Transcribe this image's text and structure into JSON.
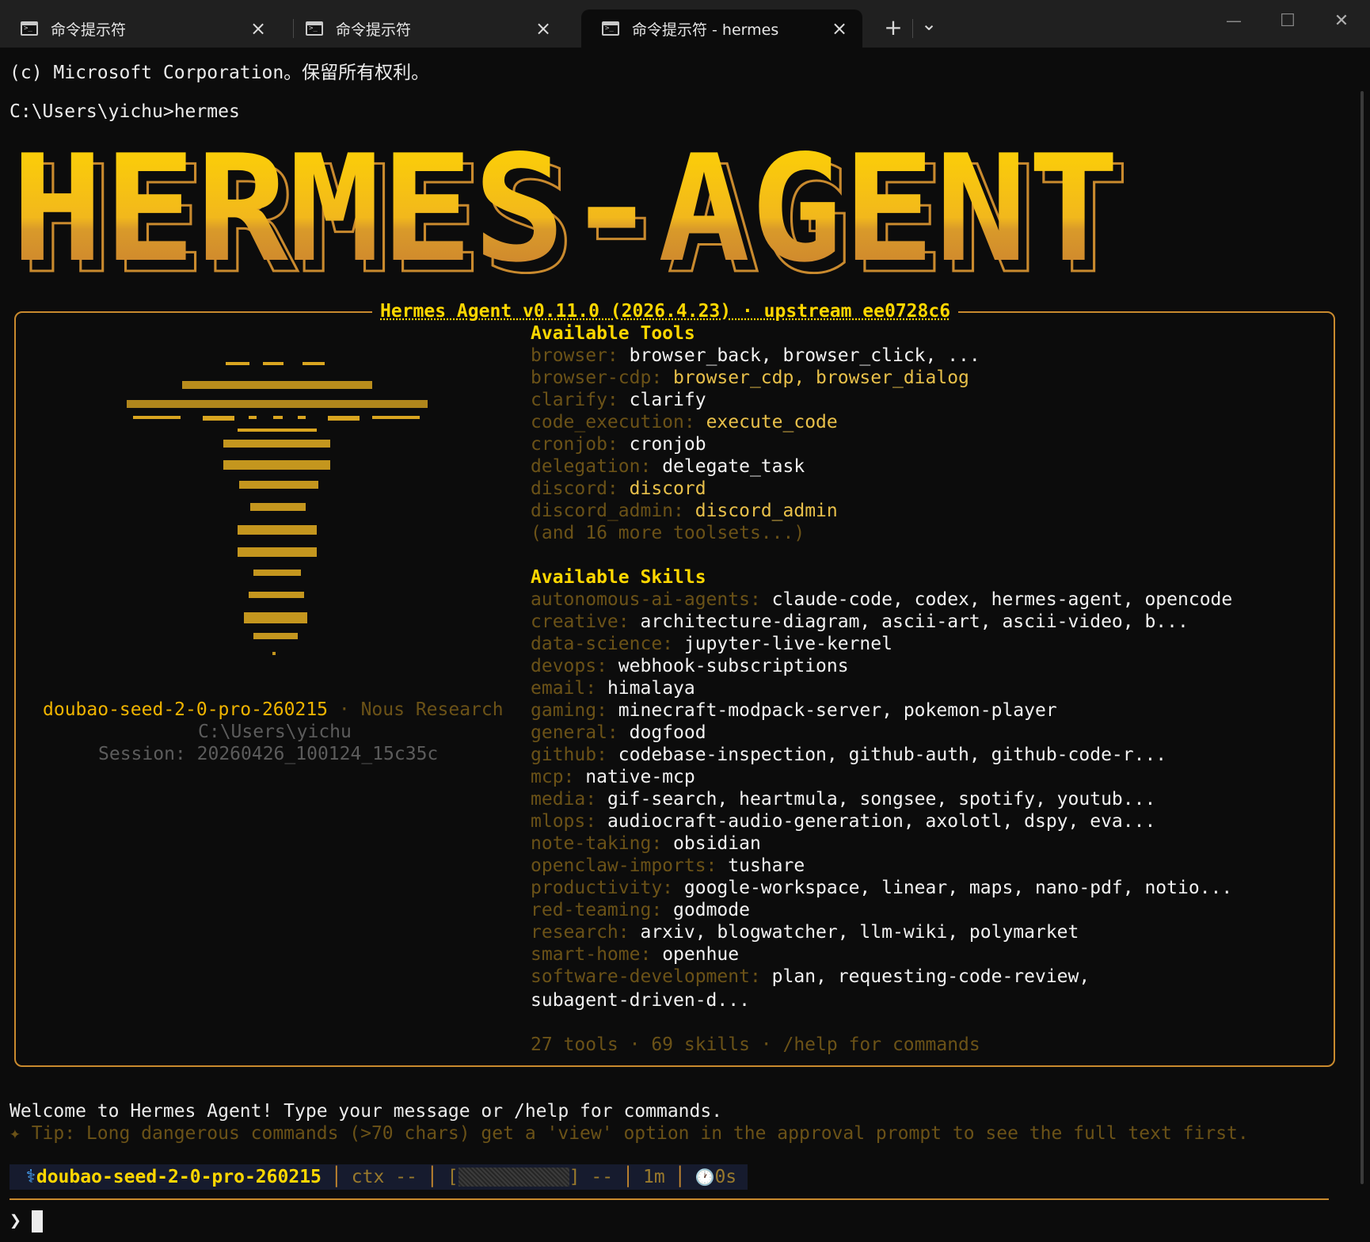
{
  "tabs": [
    {
      "label": "命令提示符",
      "active": false
    },
    {
      "label": "命令提示符",
      "active": false
    },
    {
      "label": "命令提示符 - hermes",
      "active": true
    }
  ],
  "window_controls": {
    "new_tab": "+",
    "dropdown": "⌄",
    "minimize": "—",
    "maximize": "☐",
    "close": "✕"
  },
  "terminal": {
    "copyright": "(c) Microsoft Corporation。保留所有权利。",
    "command_line": "C:\\Users\\yichu>hermes",
    "banner_text": "HERMES-AGENT"
  },
  "panel": {
    "title": "Hermes Agent v0.11.0 (2026.4.23) · upstream ee0728c6",
    "model": "doubao-seed-2-0-pro-260215",
    "provider": "· Nous Research",
    "cwd": "C:\\Users\\yichu",
    "session": "Session: 20260426_100124_15c35c",
    "tools_heading": "Available Tools",
    "tools": [
      {
        "cat": "browser:",
        "val": "browser_back, browser_click, ...",
        "gold": false
      },
      {
        "cat": "browser-cdp:",
        "val": "browser_cdp, browser_dialog",
        "gold": true
      },
      {
        "cat": "clarify:",
        "val": "clarify",
        "gold": false
      },
      {
        "cat": "code_execution:",
        "val": "execute_code",
        "gold": true
      },
      {
        "cat": "cronjob:",
        "val": "cronjob",
        "gold": false
      },
      {
        "cat": "delegation:",
        "val": "delegate_task",
        "gold": false
      },
      {
        "cat": "discord:",
        "val": "discord",
        "gold": true
      },
      {
        "cat": "discord_admin:",
        "val": "discord_admin",
        "gold": true
      }
    ],
    "tools_more": "(and 16 more toolsets...)",
    "skills_heading": "Available Skills",
    "skills": [
      {
        "cat": "autonomous-ai-agents:",
        "val": "claude-code, codex, hermes-agent, opencode"
      },
      {
        "cat": "creative:",
        "val": "architecture-diagram, ascii-art, ascii-video, b..."
      },
      {
        "cat": "data-science:",
        "val": "jupyter-live-kernel"
      },
      {
        "cat": "devops:",
        "val": "webhook-subscriptions"
      },
      {
        "cat": "email:",
        "val": "himalaya"
      },
      {
        "cat": "gaming:",
        "val": "minecraft-modpack-server, pokemon-player"
      },
      {
        "cat": "general:",
        "val": "dogfood"
      },
      {
        "cat": "github:",
        "val": "codebase-inspection, github-auth, github-code-r..."
      },
      {
        "cat": "mcp:",
        "val": "native-mcp"
      },
      {
        "cat": "media:",
        "val": "gif-search, heartmula, songsee, spotify, youtub..."
      },
      {
        "cat": "mlops:",
        "val": "audiocraft-audio-generation, axolotl, dspy, eva..."
      },
      {
        "cat": "note-taking:",
        "val": "obsidian"
      },
      {
        "cat": "openclaw-imports:",
        "val": "tushare"
      },
      {
        "cat": "productivity:",
        "val": "google-workspace, linear, maps, nano-pdf, notio..."
      },
      {
        "cat": "red-teaming:",
        "val": "godmode"
      },
      {
        "cat": "research:",
        "val": "arxiv, blogwatcher, llm-wiki, polymarket"
      },
      {
        "cat": "smart-home:",
        "val": "openhue"
      },
      {
        "cat": "software-development:",
        "val": "plan, requesting-code-review,"
      }
    ],
    "skills_wrap": "subagent-driven-d...",
    "summary": "27 tools · 69 skills · /help for commands"
  },
  "welcome": "Welcome to Hermes Agent! Type your message or /help for commands.",
  "tip": "✦ Tip: Long dangerous commands (>70 chars) get a 'view' option in the approval prompt to see the full text first.",
  "status": {
    "icon": "⚕",
    "model": "doubao-seed-2-0-pro-260215",
    "sep": "│",
    "ctx": "ctx --",
    "bar_open": "[",
    "bar_close": "]",
    "bar_value": "--",
    "time": "1m",
    "clock_icon": "🕐",
    "elapsed": "0s"
  },
  "prompt_symbol": "❯",
  "colors": {
    "accent_gold": "#ffd700",
    "border_orange": "#c98a2e",
    "background": "#0c0c0c"
  }
}
